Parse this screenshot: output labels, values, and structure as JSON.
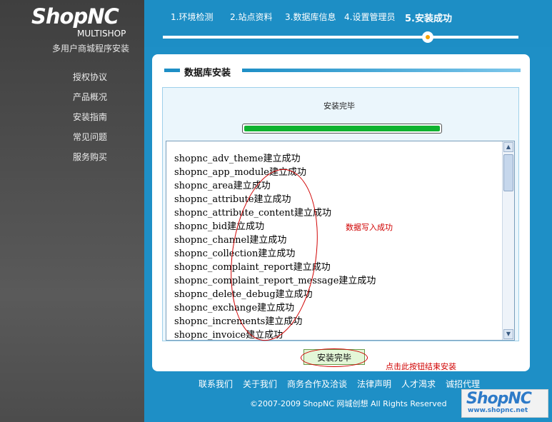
{
  "brand": {
    "logo": "ShopNC",
    "product": "MULTISHOP",
    "tagline": "多用户商城程序安装"
  },
  "sidebar": {
    "items": [
      {
        "label": "授权协议"
      },
      {
        "label": "产品概况"
      },
      {
        "label": "安装指南"
      },
      {
        "label": "常见问题"
      },
      {
        "label": "服务购买"
      }
    ]
  },
  "steps": [
    {
      "label": "1.环境检测"
    },
    {
      "label": "2.站点资料"
    },
    {
      "label": "3.数据库信息"
    },
    {
      "label": "4.设置管理员"
    },
    {
      "label": "5.安装成功"
    }
  ],
  "section": {
    "title": "数据库安装",
    "status": "安装完毕",
    "progress": 1.0
  },
  "log": {
    "lines": [
      "shopnc_adv_theme建立成功",
      "shopnc_app_module建立成功",
      "shopnc_area建立成功",
      "shopnc_attribute建立成功",
      "shopnc_attribute_content建立成功",
      "shopnc_bid建立成功",
      "shopnc_channel建立成功",
      "shopnc_collection建立成功",
      "shopnc_complaint_report建立成功",
      "shopnc_complaint_report_message建立成功",
      "shopnc_delete_debug建立成功",
      "shopnc_exchange建立成功",
      "shopnc_increments建立成功",
      "shopnc_invoice建立成功"
    ]
  },
  "annotations": {
    "write_success": "数据写入成功",
    "click_finish": "点击此按钮结束安装"
  },
  "buttons": {
    "finish": "安装完毕"
  },
  "footer": {
    "links": [
      "联系我们",
      "关于我们",
      "商务合作及洽谈",
      "法律声明",
      "人才渴求",
      "诚招代理"
    ],
    "copyright": "©2007-2009 ShopNC 网城创想 All Rights Reserved"
  },
  "watermark": {
    "logo": "ShopNC",
    "url": "www.shopnc.net"
  },
  "colors": {
    "accent": "#1e8fc6",
    "progress": "#0fb22f",
    "annotation": "#d00000"
  }
}
